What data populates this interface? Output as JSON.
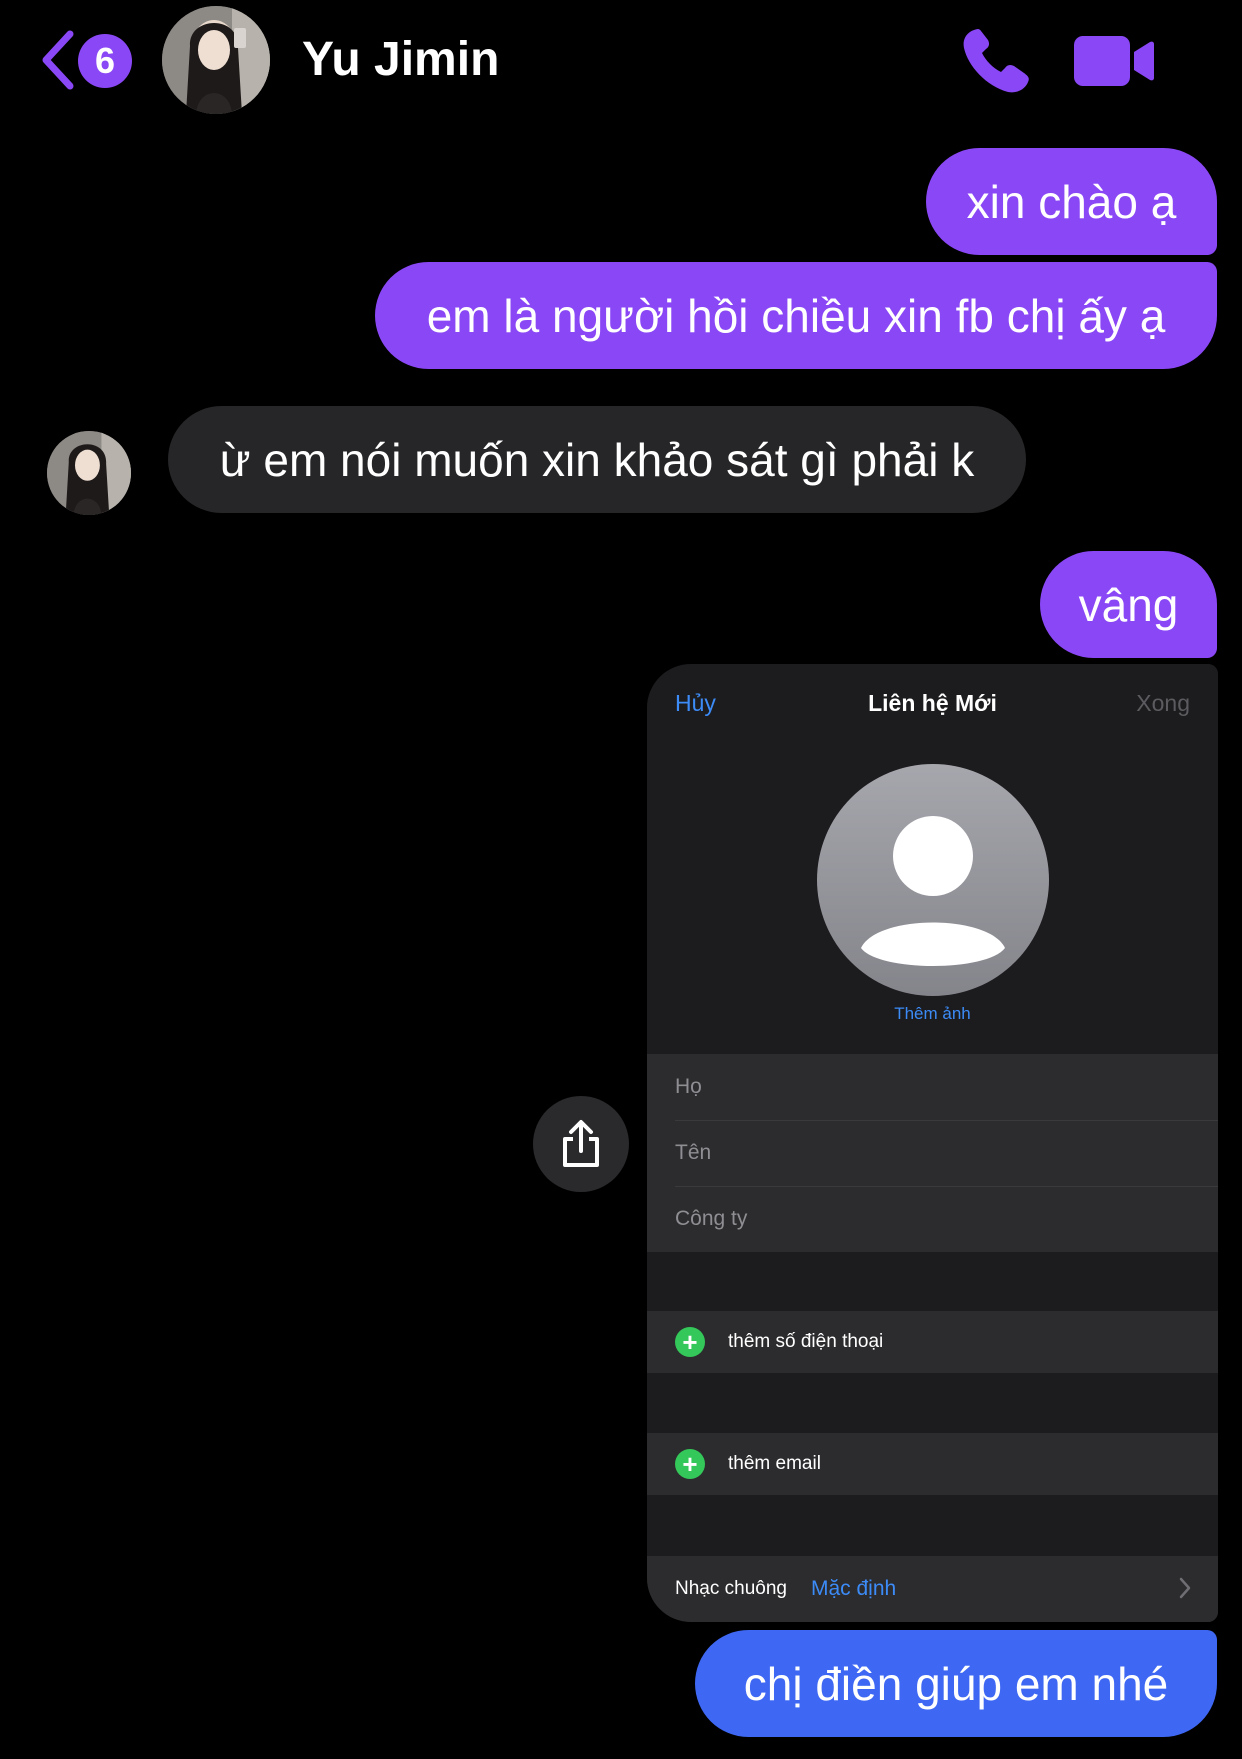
{
  "header": {
    "unread_count": "6",
    "contact_name": "Yu Jimin",
    "icons": {
      "back": "chevron-left-icon",
      "call": "phone-icon",
      "video": "video-camera-icon"
    },
    "accent_color": "#8a47f5"
  },
  "messages": [
    {
      "direction": "outgoing",
      "text": "xin chào ạ"
    },
    {
      "direction": "outgoing",
      "text": "em là người hồi chiều xin fb chị ấy ạ"
    },
    {
      "direction": "incoming",
      "text": "ừ em nói muốn xin khảo sát gì phải k"
    },
    {
      "direction": "outgoing",
      "text": "vâng"
    },
    {
      "direction": "outgoing",
      "type": "image"
    },
    {
      "direction": "outgoing",
      "text": "chị điền giúp em nhé"
    }
  ],
  "shared_image": {
    "cancel": "Hủy",
    "title": "Liên hệ Mới",
    "done": "Xong",
    "add_photo": "Thêm ảnh",
    "fields": [
      "Họ",
      "Tên",
      "Công ty"
    ],
    "add_phone": "thêm số điện thoại",
    "add_email": "thêm email",
    "ringtone_label": "Nhạc chuông",
    "ringtone_value": "Mặc định"
  },
  "share_icon": "share-icon"
}
